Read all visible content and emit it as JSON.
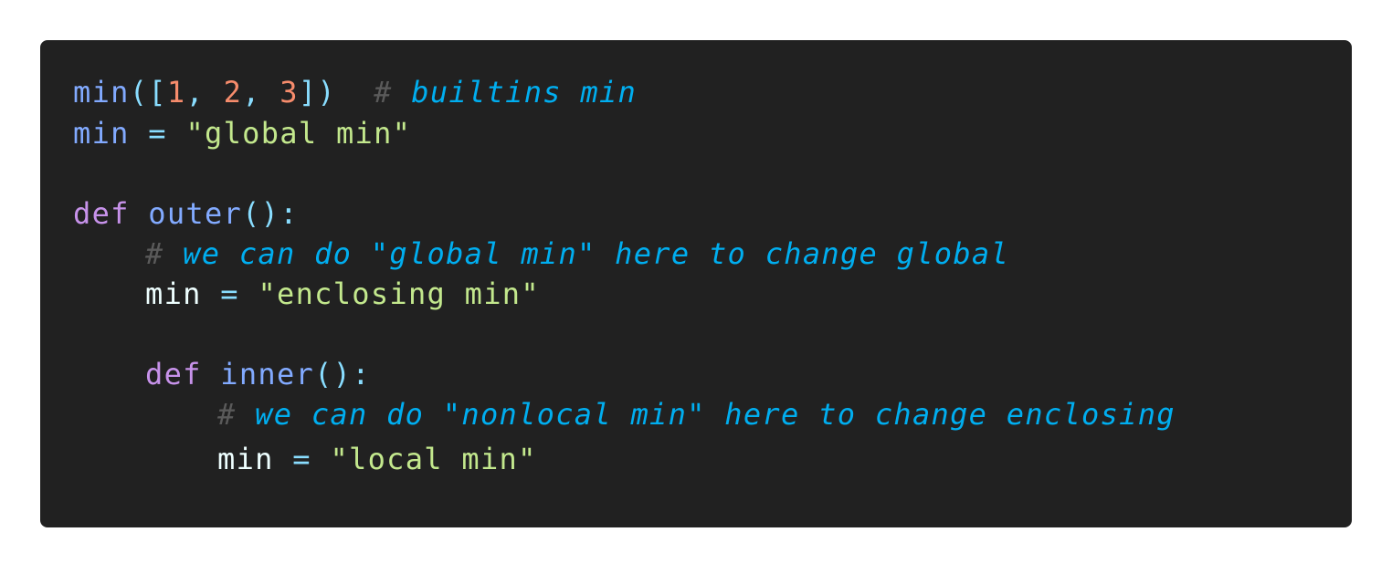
{
  "code": {
    "line1": {
      "name": "min",
      "open": "([",
      "n1": "1",
      "sep1": ", ",
      "n2": "2",
      "sep2": ", ",
      "n3": "3",
      "close": "])",
      "hash": "#",
      "comment": "builtins min"
    },
    "line2": {
      "name": "min",
      "eq": "=",
      "value": "\"global min\""
    },
    "line3": {
      "kw": "def",
      "fn": "outer",
      "parens": "():"
    },
    "line4": {
      "hash": "#",
      "comment": "we can do \"global min\" here to change global"
    },
    "line5": {
      "name": "min",
      "eq": "=",
      "value": "\"enclosing min\""
    },
    "line6": {
      "kw": "def",
      "fn": "inner",
      "parens": "():"
    },
    "line7": {
      "hash": "#",
      "comment": "we can do \"nonlocal min\" here to change enclosing"
    },
    "line8": {
      "name": "min",
      "eq": "=",
      "value": "\"local min\""
    }
  },
  "colors": {
    "background": "#212121",
    "keyword": "#c792ea",
    "function": "#82aaff",
    "number": "#f78c6c",
    "string": "#c3e88d",
    "comment": "#00aef0",
    "punctuation": "#89ddff"
  }
}
